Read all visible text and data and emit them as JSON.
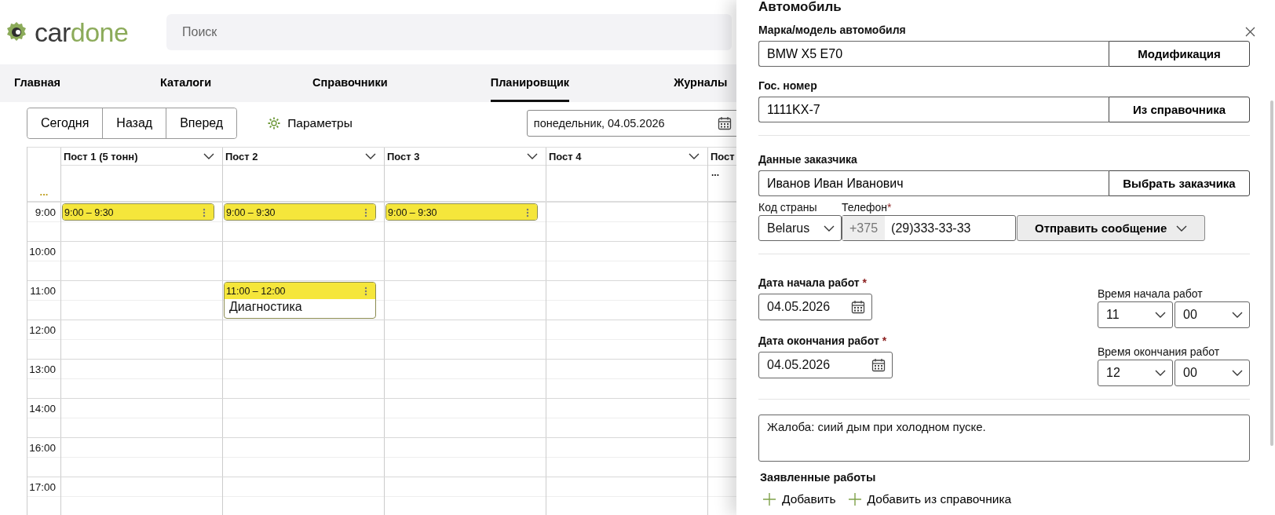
{
  "header": {
    "logo": [
      "car",
      "done"
    ],
    "search": {
      "placeholder": "Поиск"
    }
  },
  "nav": [
    {
      "label": "Главная",
      "selected": false
    },
    {
      "label": "Каталоги",
      "selected": false
    },
    {
      "label": "Справочники",
      "selected": false
    },
    {
      "label": "Планировщик",
      "selected": true
    },
    {
      "label": "Журналы",
      "selected": false
    }
  ],
  "toolbar": {
    "buttons": [
      "Сегодня",
      "Назад",
      "Вперед"
    ],
    "settings": "Параметры",
    "date": "понедельник, 04.05.2026"
  },
  "scheduler": {
    "corner_more": "...",
    "posts": [
      {
        "name": "Пост 1 (5 тонн)"
      },
      {
        "name": "Пост 2"
      },
      {
        "name": "Пост 3"
      },
      {
        "name": "Пост 4"
      },
      {
        "name": "Пост",
        "more": "..."
      }
    ],
    "rows": [
      {
        "time": "9:00",
        "cells": [
          {
            "kind": "half",
            "time": "9:00 – 9:30"
          },
          {
            "kind": "half",
            "time": "9:00 – 9:30"
          },
          {
            "kind": "half",
            "time": "9:00 – 9:30"
          },
          null,
          null
        ]
      },
      {
        "time": "10:00",
        "cells": [
          null,
          null,
          null,
          null,
          null
        ]
      },
      {
        "time": "11:00",
        "cells": [
          null,
          {
            "kind": "hour",
            "time": "11:00 – 12:00",
            "title": "Диагностика"
          },
          null,
          null,
          null
        ]
      },
      {
        "time": "12:00",
        "cells": [
          null,
          null,
          null,
          null,
          null
        ]
      },
      {
        "time": "13:00",
        "cells": [
          null,
          null,
          null,
          null,
          null
        ]
      },
      {
        "time": "14:00",
        "cells": [
          null,
          null,
          null,
          null,
          null
        ]
      },
      {
        "time": "16:00",
        "cells": [
          null,
          null,
          null,
          null,
          null
        ]
      },
      {
        "time": "17:00",
        "cells": [
          null,
          null,
          null,
          null,
          null
        ]
      }
    ]
  },
  "panel": {
    "section_title": "Автомобиль",
    "car": {
      "label": "Марка/модель автомобиля",
      "value": "BMW X5 E70",
      "button": "Модификация"
    },
    "plate": {
      "label": "Гос. номер",
      "value": "1111KX-7",
      "button": "Из справочника"
    },
    "customer": {
      "label": "Данные заказчика",
      "value": "Иванов Иван Иванович",
      "button": "Выбрать заказчика"
    },
    "country": {
      "label": "Код страны",
      "value": "Belarus"
    },
    "phone": {
      "label": "Телефон",
      "required_mark": "*",
      "prefix": "+375",
      "value": "(29)333-33-33",
      "button": "Отправить сообщение"
    },
    "start_date": {
      "label": "Дата начала работ",
      "required_mark": "*",
      "value": "04.05.2026"
    },
    "start_time": {
      "label": "Время начала работ",
      "hour": "11",
      "minute": "00"
    },
    "end_date": {
      "label": "Дата окончания работ",
      "required_mark": "*",
      "value": "04.05.2026"
    },
    "end_time": {
      "label": "Время окончания работ",
      "hour": "12",
      "minute": "00"
    },
    "complaint": "Жалоба: сиий дым при холодном пуске.",
    "works": {
      "title": "Заявленные работы",
      "actions": [
        "Добавить",
        "Добавить из справочника"
      ]
    }
  }
}
